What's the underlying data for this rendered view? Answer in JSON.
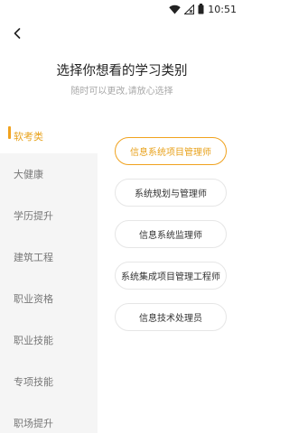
{
  "status_bar": {
    "time": "10:51",
    "icons": [
      "wifi-icon",
      "signal-icon",
      "battery-icon"
    ]
  },
  "header": {
    "back_icon": "chevron-left-icon",
    "title": "选择你想看的学习类别",
    "subtitle": "随时可以更改,请放心选择"
  },
  "categories": [
    {
      "label": "软考类",
      "active": true
    },
    {
      "label": "大健康",
      "active": false
    },
    {
      "label": "学历提升",
      "active": false
    },
    {
      "label": "建筑工程",
      "active": false
    },
    {
      "label": "职业资格",
      "active": false
    },
    {
      "label": "职业技能",
      "active": false
    },
    {
      "label": "专项技能",
      "active": false
    },
    {
      "label": "职场提升",
      "active": false
    }
  ],
  "options": [
    {
      "label": "信息系统项目管理师",
      "selected": true
    },
    {
      "label": "系统规划与管理师",
      "selected": false
    },
    {
      "label": "信息系统监理师",
      "selected": false
    },
    {
      "label": "系统集成项目管理工程师",
      "selected": false
    },
    {
      "label": "信息技术处理员",
      "selected": false
    }
  ],
  "colors": {
    "accent": "#f0a21e",
    "sidebar_bg": "#f5f5f5",
    "subtitle": "#a8a8a8"
  }
}
